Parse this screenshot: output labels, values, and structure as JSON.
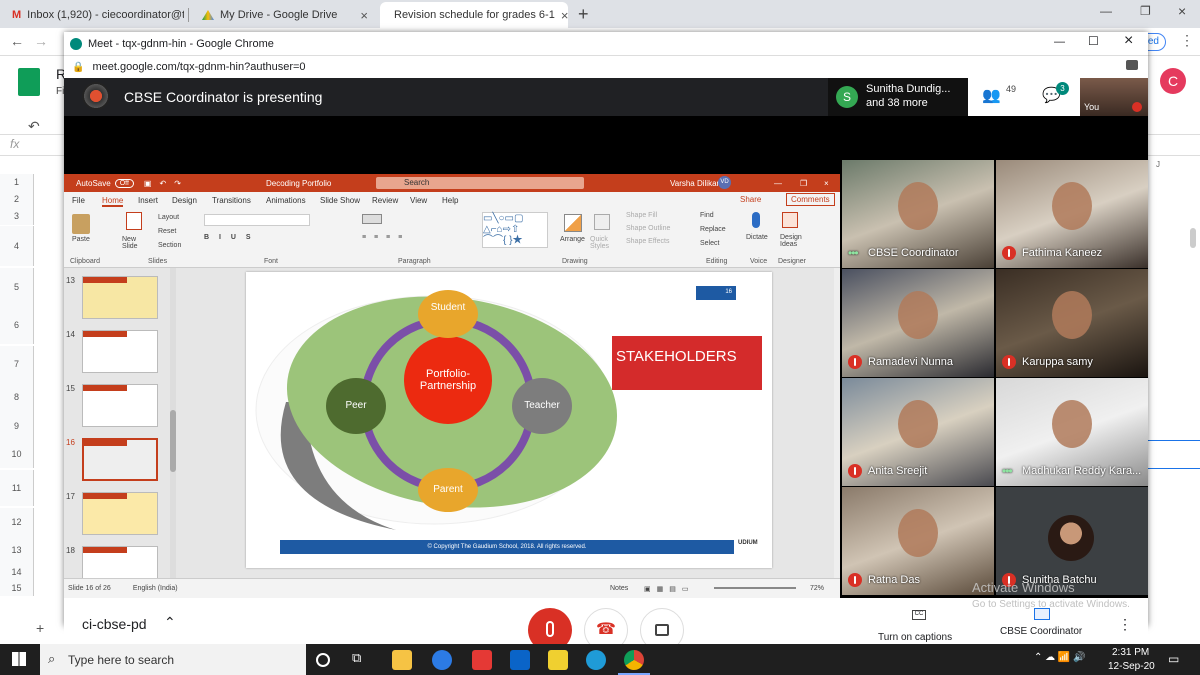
{
  "browser_tabs": [
    {
      "label": "Inbox (1,920) - ciecoordinator@t",
      "icon": "gmail-icon"
    },
    {
      "label": "My Drive - Google Drive",
      "icon": "drive-icon"
    },
    {
      "label": "Revision schedule for grades 6-1",
      "icon": "sheets-icon"
    }
  ],
  "new_tab": "+",
  "sheet": {
    "title_letter": "R",
    "menu_letter": "Fi",
    "fx": "fx",
    "column_j": "J",
    "row_numbers": [
      "1",
      "2",
      "3",
      "4",
      "5",
      "6",
      "7",
      "8",
      "9",
      "10",
      "11",
      "12",
      "13",
      "14",
      "15"
    ],
    "sheet_tab": "ci-cbse-pd",
    "add_sheet": "+",
    "right_badge": "sed",
    "avatar_letter": "C"
  },
  "meet": {
    "window_title": "Meet - tqx-gdnm-hin - Google Chrome",
    "url": "meet.google.com/tqx-gdnm-hin?authuser=0",
    "presenting": "CBSE Coordinator is presenting",
    "participants_avatar": "S",
    "participants_line1": "Sunitha Dundig...",
    "participants_line2": "and 38 more",
    "people_count": "49",
    "chat_count": "3",
    "self_label": "You",
    "caption_label": "Turn on captions",
    "presenter_label": "CBSE Coordinator",
    "watermark_line1": "Activate Windows",
    "watermark_line2": "Go to Settings to activate Windows."
  },
  "ppt": {
    "autosave": "AutoSave",
    "autosave_state": "Off",
    "file_title": "Decoding Portfolio",
    "search": "Search",
    "user": "Varsha Dilikar",
    "user_initials": "VD",
    "menu": [
      "File",
      "Home",
      "Insert",
      "Design",
      "Transitions",
      "Animations",
      "Slide Show",
      "Review",
      "View",
      "Help"
    ],
    "share": "Share",
    "comments": "Comments",
    "ribbon_groups": [
      "Clipboard",
      "Slides",
      "Font",
      "Paragraph",
      "Drawing",
      "Editing",
      "Voice",
      "Designer"
    ],
    "ribbon_items": {
      "paste": "Paste",
      "new_slide": "New Slide",
      "layout": "Layout",
      "reset": "Reset",
      "section": "Section",
      "arrange": "Arrange",
      "quick_styles": "Quick Styles",
      "shape_fill": "Shape Fill",
      "shape_outline": "Shape Outline",
      "shape_effects": "Shape Effects",
      "find": "Find",
      "replace": "Replace",
      "select": "Select",
      "dictate": "Dictate",
      "design_ideas": "Design Ideas"
    },
    "thumb_numbers": [
      "13",
      "14",
      "15",
      "16",
      "17",
      "18"
    ],
    "status_slide": "Slide 16 of 26",
    "status_lang": "English (India)",
    "notes": "Notes",
    "zoom": "72%"
  },
  "slide": {
    "center": "Portfolio-Partnership",
    "nodes": {
      "top": "Student",
      "right": "Teacher",
      "bottom": "Parent",
      "left": "Peer"
    },
    "stakeholders": "STAKEHOLDERS",
    "page_number": "16",
    "footer": "© Copyright The Gaudium School, 2018. All rights reserved.",
    "logo_text": "UDIUM"
  },
  "participants": [
    {
      "name": "CBSE Coordinator",
      "status": "speaking"
    },
    {
      "name": "Fathima Kaneez",
      "status": "muted"
    },
    {
      "name": "Ramadevi Nunna",
      "status": "muted"
    },
    {
      "name": "Karuppa samy",
      "status": "muted"
    },
    {
      "name": "Anita Sreejit",
      "status": "muted"
    },
    {
      "name": "Madhukar Reddy Kara...",
      "status": "speaking"
    },
    {
      "name": "Ratna Das",
      "status": "muted"
    },
    {
      "name": "Sunitha Batchu",
      "status": "muted"
    }
  ],
  "taskbar": {
    "search": "Type here to search",
    "time": "2:31 PM",
    "date": "12-Sep-20"
  },
  "colors": {
    "ppt_red": "#c43e1c",
    "green_ellipse": "#9cc47a",
    "ring": "#7b4fa8",
    "node_orange": "#e8a62c",
    "node_dark_green": "#4e6b2f",
    "node_gray": "#7d7d7d",
    "center_red": "#ec2a10",
    "stake_red": "#d42b2b",
    "footer_blue": "#1e5aa3"
  }
}
